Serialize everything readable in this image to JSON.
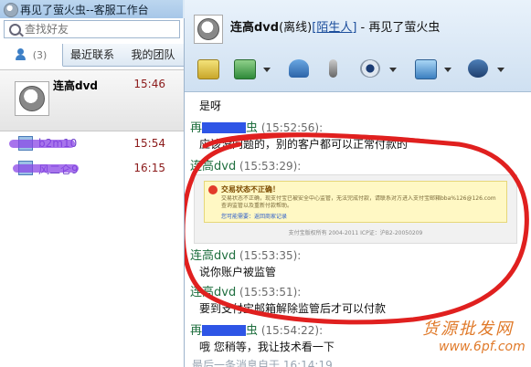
{
  "window": {
    "title": "再见了萤火虫--客服工作台"
  },
  "search": {
    "placeholder": "查找好友"
  },
  "tabs": [
    {
      "label": "(3)"
    },
    {
      "label": "最近联系"
    },
    {
      "label": "我的团队"
    }
  ],
  "contacts": [
    {
      "name": "连高dvd",
      "time": "15:46"
    },
    {
      "name": "b2m10",
      "time": "15:54"
    },
    {
      "name": "风二仑9",
      "time": "16:15"
    }
  ],
  "header": {
    "name": "连高dvd",
    "status": "(离线)",
    "tag": "[陌生人]",
    "suffix": " - 再见了萤火虫"
  },
  "toolbar": [
    "quick-reply-icon",
    "transfer-icon",
    "add-contact-icon",
    "voice-icon",
    "video-icon",
    "remote-assist-icon",
    "service-icon"
  ],
  "messages": [
    {
      "text": "是呀"
    },
    {
      "who": "再",
      "who_tail": "虫",
      "time": "(15:52:56):",
      "text": "应该没问题的，别的客户都可以正常付款的"
    },
    {
      "who": "连高dvd",
      "time": "(15:53:29):"
    },
    {
      "who": "连高dvd",
      "time": "(15:53:35):",
      "text": "说你账户被监管"
    },
    {
      "who": "连高dvd",
      "time": "(15:53:51):",
      "text": "要到支付宝邮箱解除监管后才可以付款"
    },
    {
      "who": "再",
      "who_tail": "虫",
      "time": "(15:54:22):",
      "text": "哦  您稍等，我让技术看一下"
    },
    {
      "text": "最后一条消息自于 16:14:19"
    }
  ],
  "screenshot": {
    "title": "交易状态不正确！",
    "body": "交易状态不正确，现支付宝已被安全中心监管，无法完成付款，请联系对方进入支付宝邮箱bba%126@126.com查询监管以及重新付款帮助。",
    "link": "您可能需要：返回商家记录",
    "footer": "支付宝版权所有  2004-2011  ICP证：沪B2-20050209"
  },
  "watermark": {
    "line1": "货源批发网",
    "line2": "www.6pf.com"
  }
}
